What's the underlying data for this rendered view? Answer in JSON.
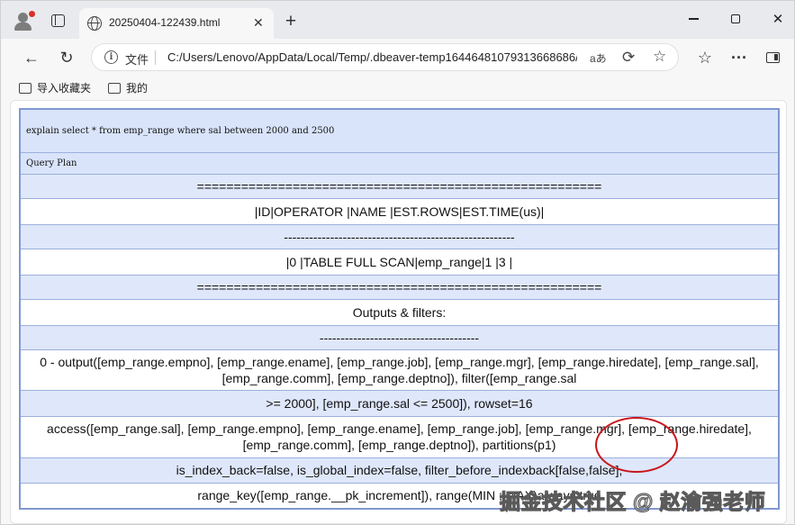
{
  "browser": {
    "tab_title": "20250404-122439.html",
    "tab_close": "✕",
    "new_tab": "+",
    "address_prefix": "文件",
    "url": "C:/Users/Lenovo/AppData/Local/Temp/.dbeaver-temp16446481079313668686/...",
    "read_aloud": "aあ",
    "window_close": "✕"
  },
  "bookmarks": [
    {
      "label": "导入收藏夹"
    },
    {
      "label": "我的"
    }
  ],
  "plan": {
    "sql": "explain select * from emp_range where sal between 2000 and 2500",
    "header": "Query Plan",
    "lines": [
      "=======================================================",
      "|ID|OPERATOR |NAME |EST.ROWS|EST.TIME(us)|",
      "-------------------------------------------------------",
      "|0 |TABLE FULL SCAN|emp_range|1 |3 |",
      "=======================================================",
      "Outputs & filters:",
      "--------------------------------------",
      "0 - output([emp_range.empno], [emp_range.ename], [emp_range.job], [emp_range.mgr], [emp_range.hiredate], [emp_range.sal], [emp_range.comm], [emp_range.deptno]), filter([emp_range.sal",
      ">= 2000], [emp_range.sal <= 2500]), rowset=16",
      "access([emp_range.sal], [emp_range.empno], [emp_range.ename], [emp_range.job], [emp_range.mgr], [emp_range.hiredate], [emp_range.comm], [emp_range.deptno]), partitions(p1)",
      "is_index_back=false, is_global_index=false, filter_before_indexback[false,false],",
      "range_key([emp_range.__pk_increment]), range(MIN ; MAX)always true"
    ]
  },
  "watermark": {
    "footer": "掘金技术社区 @ 赵渝强老师"
  }
}
